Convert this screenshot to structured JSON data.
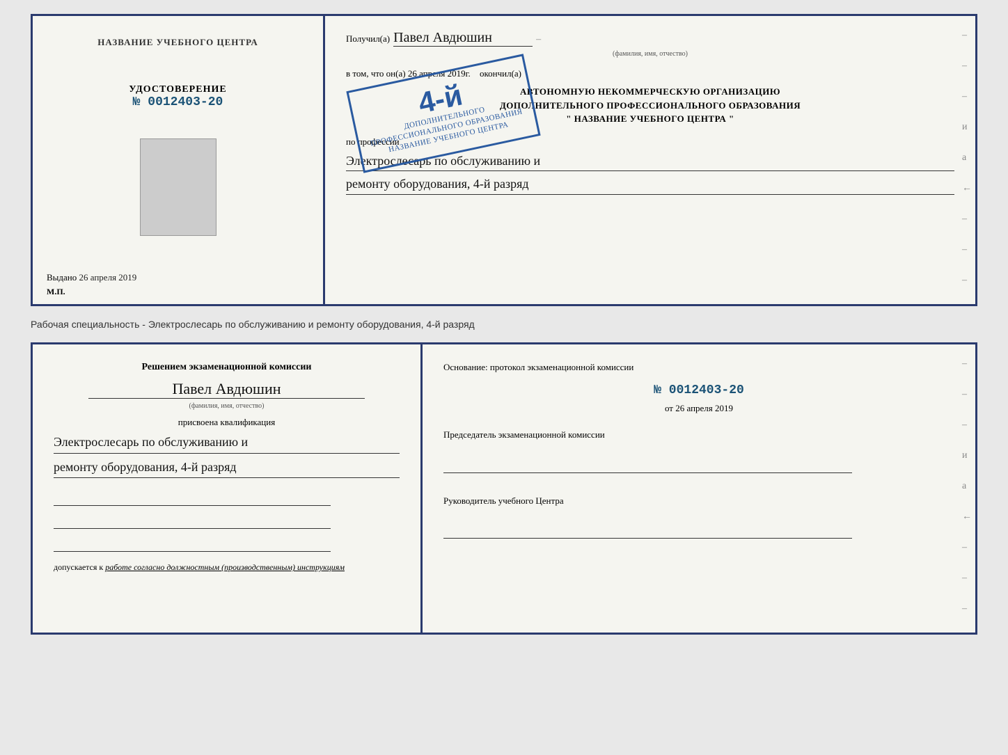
{
  "page": {
    "background": "#e8e8e8"
  },
  "top_document": {
    "left_panel": {
      "title": "НАЗВАНИЕ УЧЕБНОГО ЦЕНТРА",
      "cert_label": "УДОСТОВЕРЕНИЕ",
      "cert_number": "№ 0012403-20",
      "issued_label": "Выдано",
      "issued_date": "26 апреля 2019",
      "mp_label": "М.П."
    },
    "right_panel": {
      "received_prefix": "Получил(а)",
      "recipient_name": "Павел Авдюшин",
      "fio_label": "(фамилия, имя, отчество)",
      "date_prefix": "в том, что он(а)",
      "date_value": "26 апреля 2019г.",
      "date_suffix": "окончил(а)",
      "org_line1": "АВТОНОМНУЮ НЕКОММЕРЧЕСКУЮ ОРГАНИЗАЦИЮ",
      "org_line2": "ДОПОЛНИТЕЛЬНОГО ПРОФЕССИОНАЛЬНОГО ОБРАЗОВАНИЯ",
      "org_line3": "\" НАЗВАНИЕ УЧЕБНОГО ЦЕНТРА \"",
      "profession_label": "по профессии",
      "profession_line1": "Электрослесарь по обслуживанию и",
      "profession_line2": "ремонту оборудования, 4-й разряд"
    },
    "stamp": {
      "grade": "4-й",
      "line1": "АВТОНОМНУЮ НЕКОММЕРЧЕСКУЮ ОРГАНИЗАЦИЮ",
      "line2": "ДОПОЛНИТЕЛЬНОГО ПРОФЕССИОНАЛЬНОГО ОБРАЗОВАНИЯ",
      "line3": "НАЗВАНИЕ УЧЕБНОГО ЦЕНТРА"
    }
  },
  "separator": {
    "text": "Рабочая специальность - Электрослесарь по обслуживанию и ремонту оборудования, 4-й разряд"
  },
  "bottom_document": {
    "left_panel": {
      "decision_title": "Решением экзаменационной комиссии",
      "person_name": "Павел Авдюшин",
      "fio_label": "(фамилия, имя, отчество)",
      "qualification_label": "присвоена квалификация",
      "qual_line1": "Электрослесарь по обслуживанию и",
      "qual_line2": "ремонту оборудования, 4-й разряд",
      "допускается_prefix": "допускается к",
      "допускается_text": "работе согласно должностным (производственным) инструкциям"
    },
    "right_panel": {
      "basis_label": "Основание: протокол экзаменационной комиссии",
      "protocol_number": "№ 0012403-20",
      "date_prefix": "от",
      "date_value": "26 апреля 2019",
      "chairman_title": "Председатель экзаменационной комиссии",
      "director_title": "Руководитель учебного Центра"
    }
  },
  "right_decorations": {
    "dashes": [
      "-",
      "-",
      "-",
      "и",
      "а",
      "←",
      "-",
      "-",
      "-"
    ]
  }
}
